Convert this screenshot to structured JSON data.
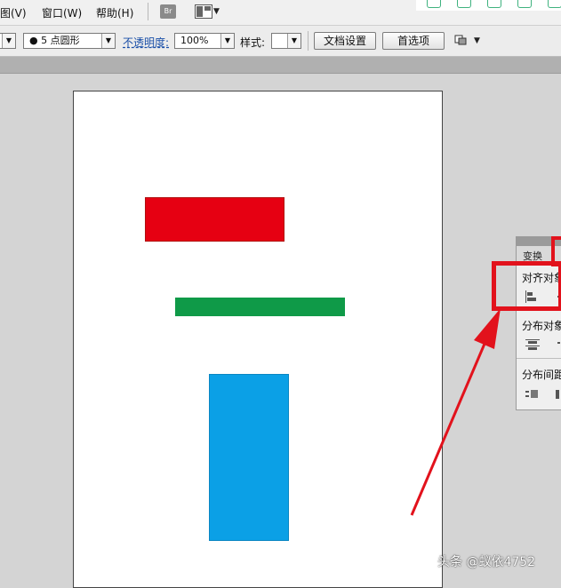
{
  "menu": {
    "view": "图(V)",
    "window": "窗口(W)",
    "help": "帮助(H)",
    "bridge_badge": "Br"
  },
  "toolbar": {
    "brush_value": "●  5 点圆形",
    "opacity_label": "不透明度:",
    "opacity_value": "100%",
    "style_label": "样式:",
    "document_setup": "文档设置",
    "preferences": "首选项"
  },
  "artboard": {
    "shapes": [
      {
        "name": "red-rectangle",
        "color": "#e60012"
      },
      {
        "name": "green-rectangle",
        "color": "#0f9a48"
      },
      {
        "name": "blue-rectangle",
        "color": "#0ba0e6"
      }
    ]
  },
  "panel": {
    "tab_transform": "变换",
    "align_objects": "对齐对象",
    "distribute_objects": "分布对象",
    "distribute_spacing": "分布间距"
  },
  "annotation": {
    "color": "#e2121c"
  },
  "watermark": "头条 @蚁依4752"
}
